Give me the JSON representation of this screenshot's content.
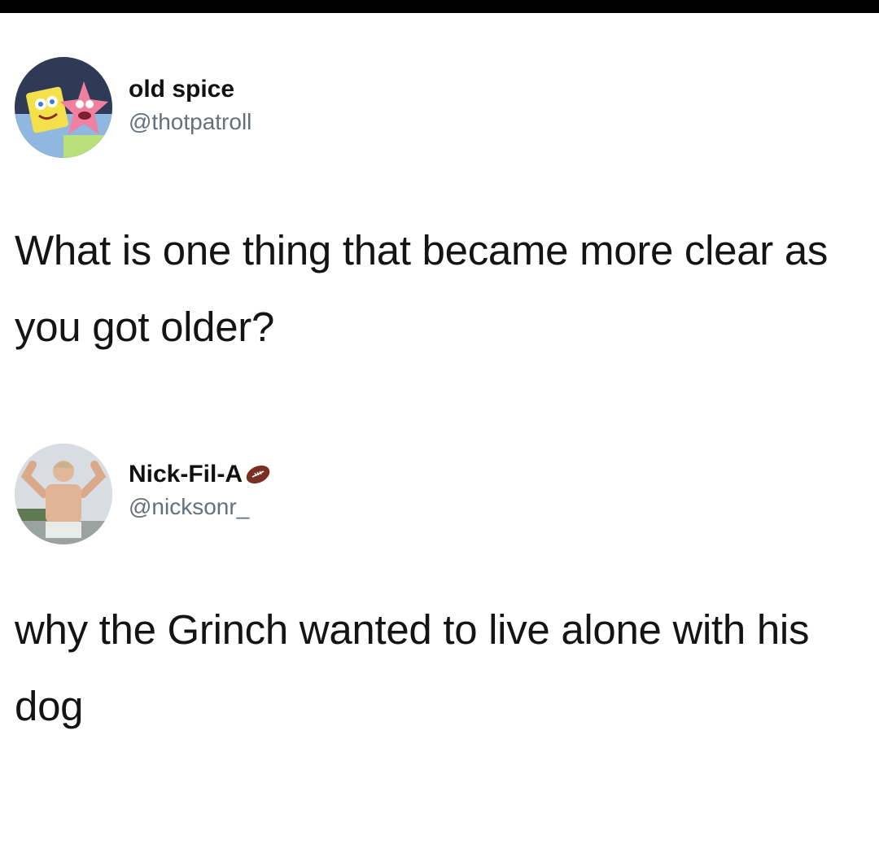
{
  "tweets": [
    {
      "display_name": "old spice",
      "handle": "@thotpatroll",
      "avatar_icon": "cartoon-avatar-icon",
      "text": "What is one thing that became more clear as you got older?"
    },
    {
      "display_name": "Nick-Fil-A",
      "handle": "@nicksonr_",
      "avatar_icon": "person-avatar-icon",
      "name_emoji": "football-emoji-icon",
      "text": "why the Grinch wanted to live alone with his dog"
    }
  ]
}
